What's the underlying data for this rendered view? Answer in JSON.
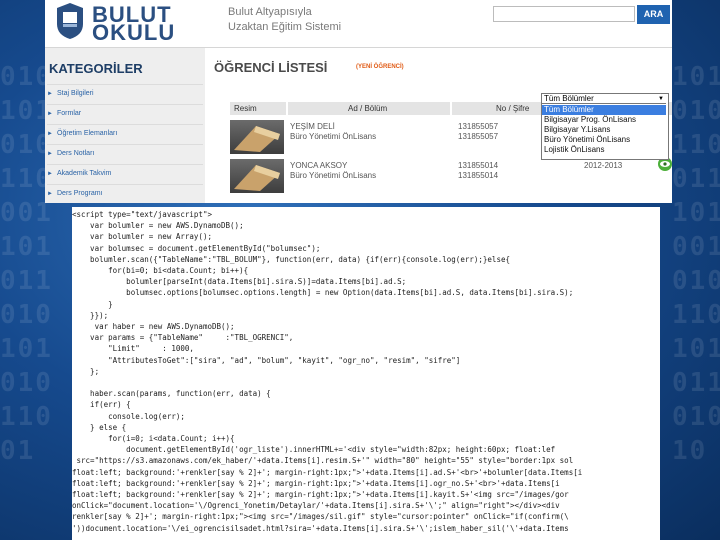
{
  "header": {
    "logo_line1": "BULUT",
    "logo_line2": "OKULU",
    "system_line1": "Bulut Altyapısıyla",
    "system_line2": "Uzaktan Eğitim Sistemi",
    "search_placeholder": "",
    "search_button": "ARA"
  },
  "sidebar": {
    "title": "KATEGORİLER",
    "items": [
      {
        "label": "Staj Bilgileri"
      },
      {
        "label": "Formlar"
      },
      {
        "label": "Öğretim Elemanları"
      },
      {
        "label": "Ders Notları"
      },
      {
        "label": "Akademik Takvim"
      },
      {
        "label": "Ders Programı"
      }
    ]
  },
  "main": {
    "title": "ÖĞRENCİ LİSTESİ",
    "subtitle": "(YENİ ÖĞRENCİ)",
    "columns": [
      "Resim",
      "Ad / Bölüm",
      "No / Şifre"
    ],
    "rows": [
      {
        "name": "YEŞİM DELİ",
        "dept": "Büro Yönetimi ÖnLisans",
        "no": "131855057",
        "pass": "131855057",
        "year": ""
      },
      {
        "name": "YONCA AKSOY",
        "dept": "Büro Yönetimi ÖnLisans",
        "no": "131855014",
        "pass": "131855014",
        "year": "2012-2013"
      }
    ],
    "filter": {
      "selected": "Tüm Bölümler",
      "options": [
        "Tüm Bölümler",
        "Bilgisayar Prog. ÖnLisans",
        "Bilgisayar Y.Lisans",
        "Büro Yönetimi ÖnLisans",
        "Lojistik ÖnLisans"
      ]
    }
  },
  "code": {
    "lines": [
      "<script type=\"text/javascript\">",
      "    var bolumler = new AWS.DynamoDB();",
      "    var bolumler = new Array();",
      "    var bolumsec = document.getElementById(\"bolumsec\");",
      "    bolumler.scan({\"TableName\":\"TBL_BOLUM\"}, function(err, data) {if(err){console.log(err);}else{",
      "        for(bi=0; bi<data.Count; bi++){",
      "            bolumler[parseInt(data.Items[bi].sira.S)]=data.Items[bi].ad.S;",
      "            bolumsec.options[bolumsec.options.length] = new Option(data.Items[bi].ad.S, data.Items[bi].sira.S);",
      "        }",
      "    }});",
      "     var haber = new AWS.DynamoDB();",
      "    var params = {\"TableName\"     :\"TBL_OGRENCI\",",
      "        \"Limit\"     : 1000,",
      "        \"AttributesToGet\":[\"sira\", \"ad\", \"bolum\", \"kayit\", \"ogr_no\", \"resim\", \"sifre\"]",
      "    };",
      "",
      "    haber.scan(params, function(err, data) {",
      "    if(err) {",
      "        console.log(err);",
      "    } else {",
      "        for(i=0; i<data.Count; i++){",
      "            document.getElementById('ogr_liste').innerHTML+='<div style=\"width:82px; height:60px; float:lef",
      " src=\"https://s3.amazonaws.com/ek_haber/'+data.Items[i].resim.S+'\" width=\"80\" height=\"55\" style=\"border:1px sol",
      "float:left; background:'+renkler[say % 2]+'; margin-right:1px;\">'+data.Items[i].ad.S+'<br>'+bolumler[data.Items[i",
      "float:left; background:'+renkler[say % 2]+'; margin-right:1px;\">'+data.Items[i].ogr_no.S+'<br>'+data.Items[i",
      "float:left; background:'+renkler[say % 2]+'; margin-right:1px;\">'+data.Items[i].kayit.S+'<img src=\"/images/gor",
      "onClick=\"document.location='\\/Ogrenci_Yonetim/Detaylar/'+data.Items[i].sira.S+'\\';\" align=\"right\"></div><div",
      "renkler[say % 2]+'; margin-right:1px;\"><img src=\"/images/sil.gif\" style=\"cursor:pointer\" onClick=\"if(confirm(\\",
      "'))document.location='\\/ei_ogrencisilsadet.html?sira='+data.Items[i].sira.S+'\\';islem_haber_sil('\\'+data.Items"
    ]
  }
}
